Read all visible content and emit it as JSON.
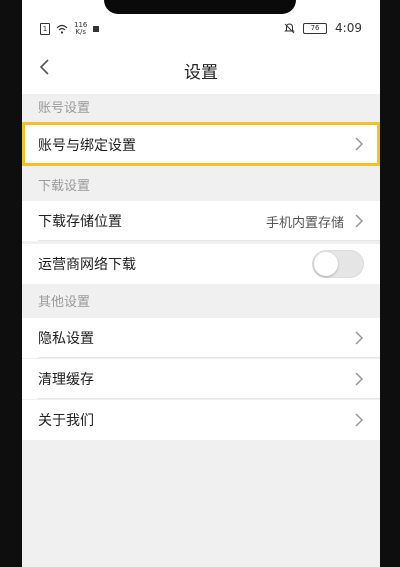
{
  "status_bar": {
    "sim_label": "1",
    "speed_top": "116",
    "speed_bottom": "K/s",
    "battery": "76",
    "time": "4:09"
  },
  "nav": {
    "title": "设置"
  },
  "sections": {
    "account": {
      "title": "账号设置",
      "items": [
        {
          "label": "账号与绑定设置"
        }
      ]
    },
    "download": {
      "title": "下载设置",
      "items": [
        {
          "label": "下载存储位置",
          "value": "手机内置存储"
        },
        {
          "label": "运营商网络下载",
          "toggle": "off"
        }
      ]
    },
    "other": {
      "title": "其他设置",
      "items": [
        {
          "label": "隐私设置"
        },
        {
          "label": "清理缓存"
        },
        {
          "label": "关于我们"
        }
      ]
    }
  },
  "colors": {
    "highlight": "#f3c12a",
    "background": "#f0f0f0"
  }
}
